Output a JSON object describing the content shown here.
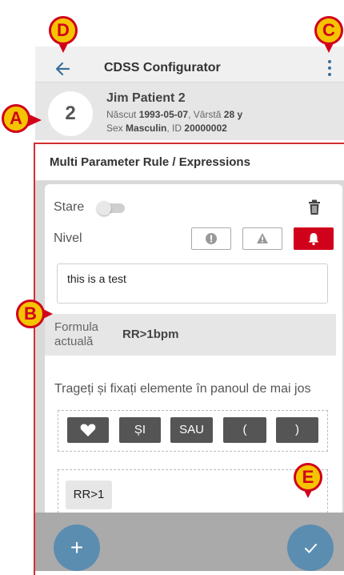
{
  "app": {
    "title": "CDSS Configurator"
  },
  "patient": {
    "bed": "2",
    "name": "Jim Patient 2",
    "born_label": "Născut",
    "born": "1993-05-07",
    "age_label": ", Vârstă",
    "age": "28 y",
    "sex_label": "Sex",
    "sex": "Masculin",
    "id_label": ", ID",
    "id": "20000002"
  },
  "section": {
    "title": "Multi Parameter Rule / Expressions"
  },
  "rule": {
    "state_label": "Stare",
    "state_on": false,
    "level_label": "Nivel",
    "levels": [
      "info",
      "warning",
      "alarm"
    ],
    "selected_level": "alarm",
    "description": "this is a test",
    "formula_label": "Formula actuală",
    "formula_value": "RR>1bpm",
    "instruction": "Trageți și fixați elemente în panoul de mai jos",
    "operators": [
      "heart",
      "ȘI",
      "SAU",
      "(",
      ")"
    ],
    "expression_chip": "RR>1"
  },
  "markers": [
    "A",
    "B",
    "C",
    "D",
    "E"
  ],
  "colors": {
    "accent": "#3a6f9a",
    "alarm": "#d0021b",
    "fab": "#5b8db1",
    "marker_fill": "#f5c400",
    "marker_border": "#d0021b"
  }
}
